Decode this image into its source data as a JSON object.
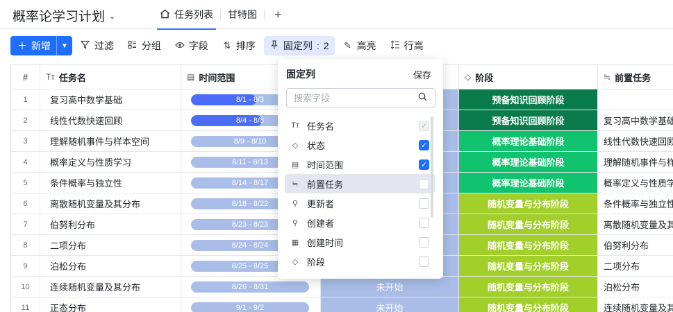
{
  "header": {
    "doc_title": "概率论学习计划",
    "tabs": [
      {
        "label": "任务列表",
        "active": true
      },
      {
        "label": "甘特图",
        "active": false
      }
    ],
    "add_tab": "+"
  },
  "toolbar": {
    "new_label": "新增",
    "filter": "过滤",
    "group": "分组",
    "fields": "字段",
    "sort": "排序",
    "pin": "固定列",
    "pin_count": "2",
    "highlight": "高亮",
    "row_height": "行高"
  },
  "columns": {
    "num": "#",
    "name": "任务名",
    "range": "时间范围",
    "stage": "阶段",
    "pre": "前置任务"
  },
  "rows": [
    {
      "num": "1",
      "name": "复习高中数学基础",
      "range": "8/1 - 8/3",
      "progress": 0.55,
      "status": "",
      "stage": "预备知识回顾阶段",
      "stage_type": "pre",
      "pre": ""
    },
    {
      "num": "2",
      "name": "线性代数快速回顾",
      "range": "8/4 - 8/8",
      "progress": 0.6,
      "status": "",
      "stage": "预备知识回顾阶段",
      "stage_type": "pre",
      "pre": "复习高中数学基础"
    },
    {
      "num": "3",
      "name": "理解随机事件与样本空间",
      "range": "8/9 - 8/10",
      "progress": 0,
      "status": "",
      "stage": "概率理论基础阶段",
      "stage_type": "prob",
      "pre": "线性代数快速回顾"
    },
    {
      "num": "4",
      "name": "概率定义与性质学习",
      "range": "8/11 - 8/13",
      "progress": 0,
      "status": "",
      "stage": "概率理论基础阶段",
      "stage_type": "prob",
      "pre": "理解随机事件与样本空间"
    },
    {
      "num": "5",
      "name": "条件概率与独立性",
      "range": "8/14 - 8/17",
      "progress": 0,
      "status": "",
      "stage": "概率理论基础阶段",
      "stage_type": "prob",
      "pre": "概率定义与性质学习"
    },
    {
      "num": "6",
      "name": "离散随机变量及其分布",
      "range": "8/18 - 8/22",
      "progress": 0,
      "status": "",
      "stage": "随机变量与分布阶段",
      "stage_type": "rv",
      "pre": "条件概率与独立性"
    },
    {
      "num": "7",
      "name": "伯努利分布",
      "range": "8/23 - 8/23",
      "progress": 0,
      "status": "",
      "stage": "随机变量与分布阶段",
      "stage_type": "rv",
      "pre": "离散随机变量及其分布"
    },
    {
      "num": "8",
      "name": "二项分布",
      "range": "8/24 - 8/24",
      "progress": 0,
      "status": "",
      "stage": "随机变量与分布阶段",
      "stage_type": "rv",
      "pre": "伯努利分布"
    },
    {
      "num": "9",
      "name": "泊松分布",
      "range": "8/25 - 8/25",
      "progress": 0,
      "status": "",
      "stage": "随机变量与分布阶段",
      "stage_type": "rv",
      "pre": "二项分布"
    },
    {
      "num": "10",
      "name": "连续随机变量及其分布",
      "range": "8/26 - 8/31",
      "progress": 0,
      "status": "未开始",
      "stage": "随机变量与分布阶段",
      "stage_type": "rv",
      "pre": "泊松分布"
    },
    {
      "num": "11",
      "name": "正态分布",
      "range": "9/1 - 9/2",
      "progress": 0,
      "status": "未开始",
      "stage": "随机变量与分布阶段",
      "stage_type": "rv",
      "pre": "连续随机变量及其分布"
    }
  ],
  "popover": {
    "title": "固定列",
    "save": "保存",
    "search_placeholder": "搜索字段",
    "items": [
      {
        "label": "任务名",
        "icon": "text-icon",
        "state": "disabled"
      },
      {
        "label": "状态",
        "icon": "tag-icon",
        "state": "checked"
      },
      {
        "label": "时间范围",
        "icon": "date-range-icon",
        "state": "checked"
      },
      {
        "label": "前置任务",
        "icon": "link-icon",
        "state": "unchecked",
        "hover": true
      },
      {
        "label": "更新者",
        "icon": "user-icon",
        "state": "unchecked"
      },
      {
        "label": "创建者",
        "icon": "user-add-icon",
        "state": "unchecked"
      },
      {
        "label": "创建时间",
        "icon": "calendar-icon",
        "state": "unchecked"
      },
      {
        "label": "阶段",
        "icon": "tag-icon",
        "state": "unchecked"
      }
    ]
  },
  "colors": {
    "accent": "#1e6fff",
    "stage_pre": "#0a7c4b",
    "stage_prob": "#11c36e",
    "stage_rv": "#a2cf2a",
    "bar": "#a9bde8",
    "bar_fill": "#4a6cf7"
  }
}
